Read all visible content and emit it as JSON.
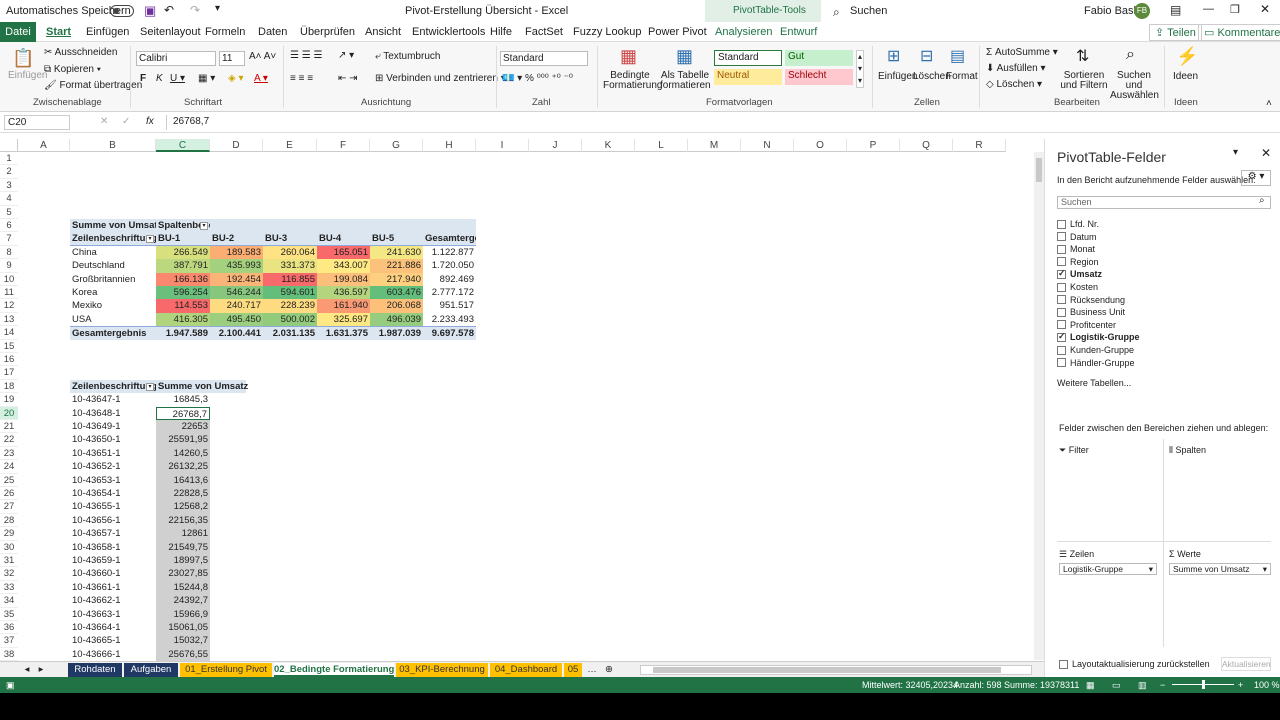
{
  "titlebar": {
    "autosave": "Automatisches Speichern",
    "title": "Pivot-Erstellung Übersicht - Excel",
    "tools": "PivotTable-Tools",
    "search": "Suchen",
    "user": "Fabio Basler",
    "initials": "FB"
  },
  "tabs": [
    "Datei",
    "Start",
    "Einfügen",
    "Seitenlayout",
    "Formeln",
    "Daten",
    "Überprüfen",
    "Ansicht",
    "Entwicklertools",
    "Hilfe",
    "FactSet",
    "Fuzzy Lookup",
    "Power Pivot",
    "Analysieren",
    "Entwurf"
  ],
  "share": "Teilen",
  "comments": "Kommentare",
  "ribbon": {
    "clipboard": {
      "paste": "Einfügen",
      "cut": "Ausschneiden",
      "copy": "Kopieren",
      "format": "Format übertragen",
      "group": "Zwischenablage"
    },
    "font": {
      "name": "Calibri",
      "size": "11",
      "group": "Schriftart"
    },
    "align": {
      "wrap": "Textumbruch",
      "merge": "Verbinden und zentrieren",
      "group": "Ausrichtung"
    },
    "number": {
      "format": "Standard",
      "group": "Zahl"
    },
    "styles": {
      "cond": "Bedingte Formatierung",
      "table": "Als Tabelle formatieren",
      "standard": "Standard",
      "gut": "Gut",
      "neutral": "Neutral",
      "schlecht": "Schlecht",
      "group": "Formatvorlagen"
    },
    "cells": {
      "insert": "Einfügen",
      "delete": "Löschen",
      "format": "Format",
      "group": "Zellen"
    },
    "edit": {
      "autosum": "AutoSumme",
      "fill": "Ausfüllen",
      "clear": "Löschen",
      "sort": "Sortieren und Filtern",
      "find": "Suchen und Auswählen",
      "group": "Bearbeiten"
    },
    "ideas": {
      "label": "Ideen",
      "group": "Ideen"
    }
  },
  "formula": {
    "namebox": "C20",
    "value": "26768,7",
    "fx": "fx"
  },
  "columns": [
    "A",
    "B",
    "C",
    "D",
    "E",
    "F",
    "G",
    "H",
    "I",
    "J",
    "K",
    "L",
    "M",
    "N",
    "O",
    "P",
    "Q",
    "R"
  ],
  "pivot1": {
    "corner": "Summe von Umsatz",
    "colhead": "Spaltenbeschriftungen",
    "rowhead": "Zeilenbeschriftungen",
    "cols": [
      "BU-1",
      "BU-2",
      "BU-3",
      "BU-4",
      "BU-5",
      "Gesamtergebnis"
    ],
    "rows": [
      {
        "label": "China",
        "values": [
          "266.549",
          "189.583",
          "260.064",
          "165.051",
          "241.630",
          "1.122.877"
        ],
        "colors": [
          "#d8e07e",
          "#fcae72",
          "#ffe283",
          "#f8696b",
          "#f3e883"
        ]
      },
      {
        "label": "Deutschland",
        "values": [
          "387.791",
          "435.993",
          "331.373",
          "343.007",
          "221.886",
          "1.720.050"
        ],
        "colors": [
          "#bcd87e",
          "#a4d17d",
          "#e9e382",
          "#fee983",
          "#fcc27b"
        ]
      },
      {
        "label": "Großbritannien",
        "values": [
          "166.136",
          "192.454",
          "116.855",
          "199.084",
          "217.940",
          "892.469"
        ],
        "colors": [
          "#f9886e",
          "#fbb478",
          "#f8696b",
          "#fcbe7b",
          "#fdd07f"
        ]
      },
      {
        "label": "Korea",
        "values": [
          "596.254",
          "546.244",
          "594.601",
          "436.597",
          "603.476",
          "2.777.172"
        ],
        "colors": [
          "#6bbf7c",
          "#86c77d",
          "#63be7b",
          "#b4d57e",
          "#63be7b"
        ]
      },
      {
        "label": "Mexiko",
        "values": [
          "114.553",
          "240.717",
          "228.239",
          "161.940",
          "206.068",
          "951.517"
        ],
        "colors": [
          "#f8696b",
          "#fddc81",
          "#fedb81",
          "#fa9a74",
          "#fcc07b"
        ]
      },
      {
        "label": "USA",
        "values": [
          "416.305",
          "495.450",
          "500.002",
          "325.697",
          "496.039",
          "2.233.493"
        ],
        "colors": [
          "#b0d47e",
          "#9bce7e",
          "#93cb7d",
          "#ffe883",
          "#95cc7d"
        ]
      }
    ],
    "total": {
      "label": "Gesamtergebnis",
      "values": [
        "1.947.589",
        "2.100.441",
        "2.031.135",
        "1.631.375",
        "1.987.039",
        "9.697.578"
      ]
    }
  },
  "pivot2": {
    "rowhead": "Zeilenbeschriftungen",
    "valhead": "Summe von Umsatz",
    "rows": [
      [
        "10-43647-1",
        "16845,3"
      ],
      [
        "10-43648-1",
        "26768,7"
      ],
      [
        "10-43649-1",
        "22653"
      ],
      [
        "10-43650-1",
        "25591,95"
      ],
      [
        "10-43651-1",
        "14260,5"
      ],
      [
        "10-43652-1",
        "26132,25"
      ],
      [
        "10-43653-1",
        "16413,6"
      ],
      [
        "10-43654-1",
        "22828,5"
      ],
      [
        "10-43655-1",
        "12568,2"
      ],
      [
        "10-43656-1",
        "22156,35"
      ],
      [
        "10-43657-1",
        "12861"
      ],
      [
        "10-43658-1",
        "21549,75"
      ],
      [
        "10-43659-1",
        "18997,5"
      ],
      [
        "10-43660-1",
        "23027,85"
      ],
      [
        "10-43661-1",
        "15244,8"
      ],
      [
        "10-43662-1",
        "24392,7"
      ],
      [
        "10-43663-1",
        "15966,9"
      ],
      [
        "10-43664-1",
        "15061,05"
      ],
      [
        "10-43665-1",
        "15032,7"
      ],
      [
        "10-43666-1",
        "25676,55"
      ]
    ]
  },
  "panel": {
    "title": "PivotTable-Felder",
    "subtitle": "In den Bericht aufzunehmende Felder auswählen:",
    "search": "Suchen",
    "fields": [
      {
        "name": "Lfd. Nr.",
        "on": false
      },
      {
        "name": "Datum",
        "on": false
      },
      {
        "name": "Monat",
        "on": false
      },
      {
        "name": "Region",
        "on": false
      },
      {
        "name": "Umsatz",
        "on": true
      },
      {
        "name": "Kosten",
        "on": false
      },
      {
        "name": "Rücksendung",
        "on": false
      },
      {
        "name": "Business Unit",
        "on": false
      },
      {
        "name": "Profitcenter",
        "on": false
      },
      {
        "name": "Logistik-Gruppe",
        "on": true
      },
      {
        "name": "Kunden-Gruppe",
        "on": false
      },
      {
        "name": "Händler-Gruppe",
        "on": false
      }
    ],
    "more": "Weitere Tabellen...",
    "drag": "Felder zwischen den Bereichen ziehen und ablegen:",
    "filter": "Filter",
    "columns": "Spalten",
    "rows": "Zeilen",
    "values": "Werte",
    "rowfield": "Logistik-Gruppe",
    "valfield": "Summe von Umsatz",
    "defer": "Layoutaktualisierung zurückstellen",
    "update": "Aktualisieren"
  },
  "sheets": [
    {
      "name": "Rohdaten",
      "bg": "#1f3864",
      "fg": "#ffffff"
    },
    {
      "name": "Aufgaben",
      "bg": "#1f3864",
      "fg": "#ffffff"
    },
    {
      "name": "01_Erstellung Pivot",
      "bg": "#ffc000",
      "fg": "#333333"
    },
    {
      "name": "02_Bedingte Formatierung",
      "bg": "#ffffff",
      "fg": "#217346"
    },
    {
      "name": "03_KPI-Berechnung",
      "bg": "#ffc000",
      "fg": "#333333"
    },
    {
      "name": "04_Dashboard",
      "bg": "#ffc000",
      "fg": "#333333"
    },
    {
      "name": "05",
      "bg": "#ffc000",
      "fg": "#333333"
    }
  ],
  "status": {
    "avg": "Mittelwert: 32405,20234",
    "count": "Anzahl: 598",
    "sum": "Summe: 19378311",
    "zoom": "100 %"
  }
}
